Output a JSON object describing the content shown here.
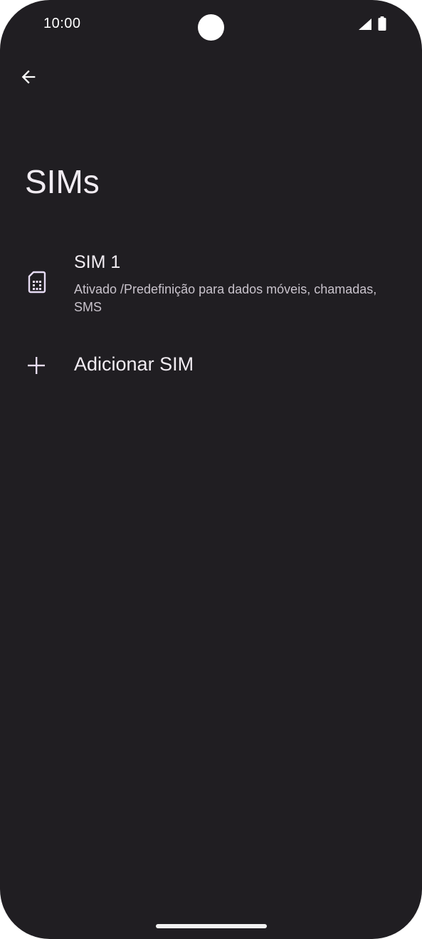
{
  "status_bar": {
    "time": "10:00",
    "icons": [
      "signal-icon",
      "battery-icon"
    ]
  },
  "toolbar": {
    "back_icon": "back-arrow-icon"
  },
  "page": {
    "title": "SIMs"
  },
  "sim_list": [
    {
      "icon": "sim-card-icon",
      "title": "SIM 1",
      "summary": "Ativado /Predefinição para dados móveis, chamadas, SMS"
    }
  ],
  "add_sim": {
    "icon": "plus-icon",
    "label": "Adicionar SIM"
  },
  "colors": {
    "background": "#201e22",
    "primary_text": "#f1ecf2",
    "secondary_text": "#c9c3cc",
    "accent_icon": "#e7dcf5"
  }
}
